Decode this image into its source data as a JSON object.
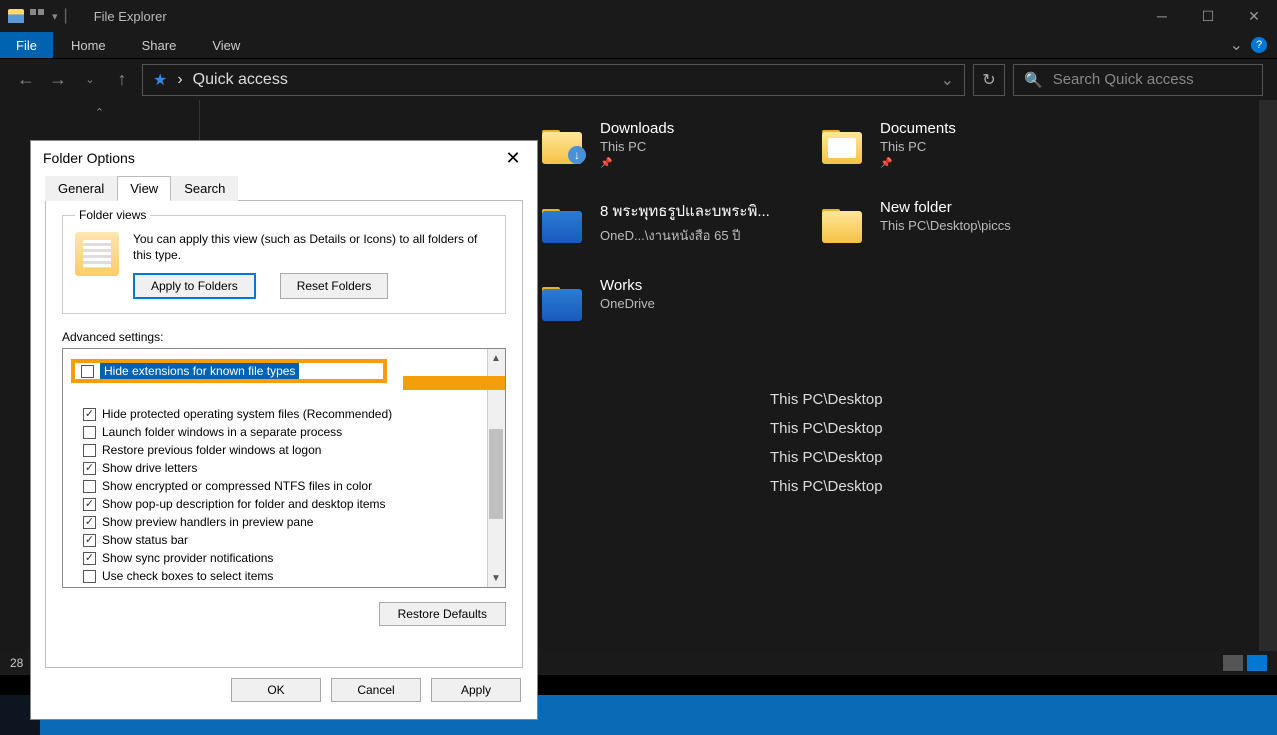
{
  "titlebar": {
    "title": "File Explorer"
  },
  "ribbon": {
    "file": "File",
    "home": "Home",
    "share": "Share",
    "view": "View"
  },
  "nav": {
    "address": "Quick access",
    "search_placeholder": "Search Quick access",
    "chevron": "›"
  },
  "folders": [
    {
      "name": "Downloads",
      "loc": "This PC",
      "pinned": true,
      "variant": "download"
    },
    {
      "name": "Documents",
      "loc": "This PC",
      "pinned": true,
      "variant": "doc"
    },
    {
      "name": "8 พระพุทธรูปและบพระพิ...",
      "loc": "OneD...\\งานหนังสือ 65 ปี",
      "pinned": false,
      "variant": "word"
    },
    {
      "name": "New folder",
      "loc": "This PC\\Desktop\\piccs",
      "pinned": false,
      "variant": "red"
    },
    {
      "name": "Works",
      "loc": "OneDrive",
      "pinned": false,
      "variant": "word"
    }
  ],
  "recent": [
    "This PC\\Desktop",
    "This PC\\Desktop",
    "This PC\\Desktop",
    "This PC\\Desktop"
  ],
  "status": {
    "count": "28"
  },
  "dialog": {
    "title": "Folder Options",
    "tabs": {
      "general": "General",
      "view": "View",
      "search": "Search"
    },
    "folder_views_label": "Folder views",
    "folder_views_text": "You can apply this view (such as Details or Icons) to all folders of this type.",
    "apply_folders": "Apply to Folders",
    "reset_folders": "Reset Folders",
    "advanced_label": "Advanced settings:",
    "highlighted": "Hide extensions for known file types",
    "settings": [
      {
        "checked": true,
        "label": "Hide protected operating system files (Recommended)"
      },
      {
        "checked": false,
        "label": "Launch folder windows in a separate process"
      },
      {
        "checked": false,
        "label": "Restore previous folder windows at logon"
      },
      {
        "checked": true,
        "label": "Show drive letters"
      },
      {
        "checked": false,
        "label": "Show encrypted or compressed NTFS files in color"
      },
      {
        "checked": true,
        "label": "Show pop-up description for folder and desktop items"
      },
      {
        "checked": true,
        "label": "Show preview handlers in preview pane"
      },
      {
        "checked": true,
        "label": "Show status bar"
      },
      {
        "checked": true,
        "label": "Show sync provider notifications"
      },
      {
        "checked": false,
        "label": "Use check boxes to select items"
      }
    ],
    "restore_defaults": "Restore Defaults",
    "ok": "OK",
    "cancel": "Cancel",
    "apply": "Apply"
  }
}
